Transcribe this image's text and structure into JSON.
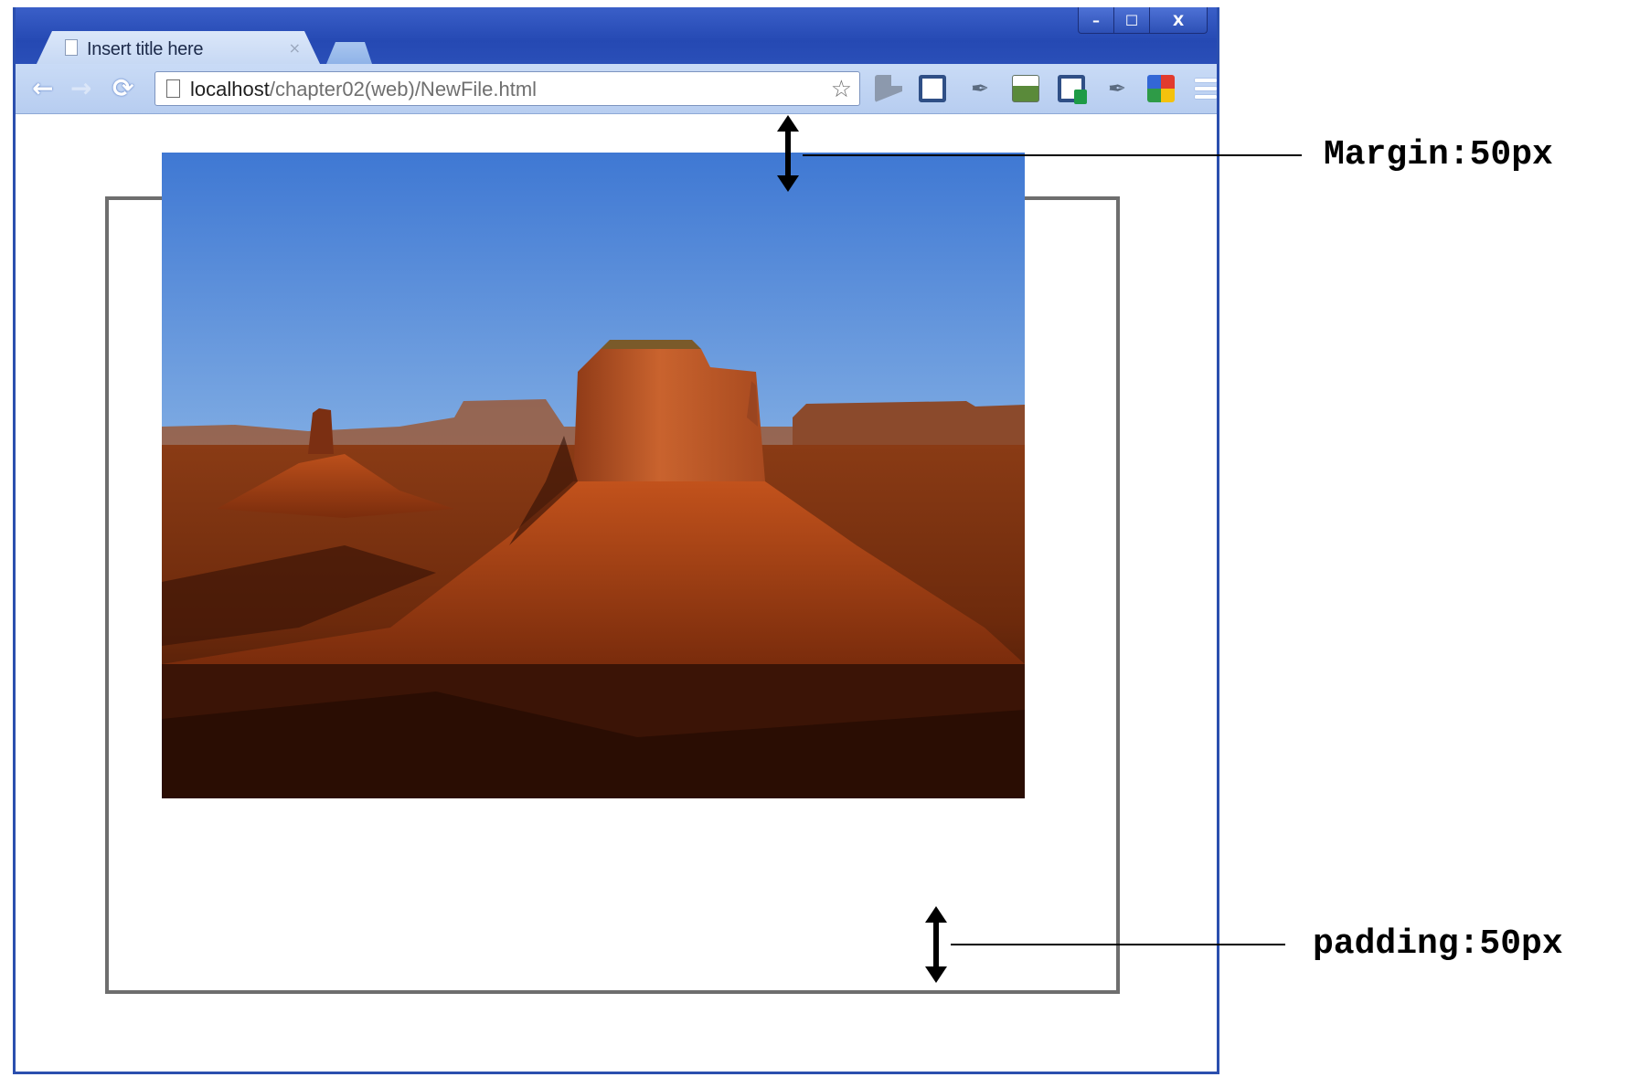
{
  "browser": {
    "tab_title": "Insert title here",
    "tab_close": "×",
    "url_host": "localhost",
    "url_path": "/chapter02(web)/NewFile.html",
    "window_controls": {
      "minimize": "–",
      "maximize": "☐",
      "close": "X"
    }
  },
  "annotations": {
    "margin_label": "Margin:50px",
    "padding_label": "padding:50px"
  },
  "colors": {
    "window_frame": "#2b4fae",
    "toolbar": "#c9dbf6",
    "box_border": "#6e6e6e"
  },
  "icons": [
    "back-arrow-icon",
    "forward-arrow-icon",
    "reload-icon",
    "page-icon",
    "star-icon",
    "menu-icon"
  ]
}
